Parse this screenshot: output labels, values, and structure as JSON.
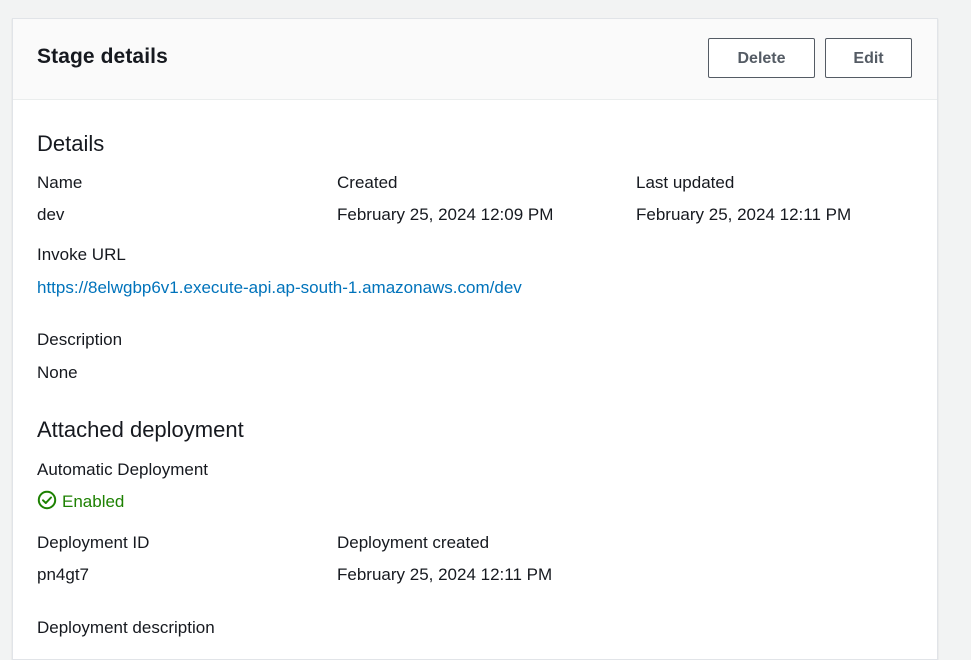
{
  "header": {
    "title": "Stage details",
    "delete_label": "Delete",
    "edit_label": "Edit"
  },
  "details": {
    "section_title": "Details",
    "name_label": "Name",
    "name_value": "dev",
    "created_label": "Created",
    "created_value": "February 25, 2024 12:09 PM",
    "last_updated_label": "Last updated",
    "last_updated_value": "February 25, 2024 12:11 PM",
    "invoke_url_label": "Invoke URL",
    "invoke_url_value": "https://8elwgbp6v1.execute-api.ap-south-1.amazonaws.com/dev",
    "description_label": "Description",
    "description_value": "None"
  },
  "deployment": {
    "section_title": "Attached deployment",
    "auto_label": "Automatic Deployment",
    "auto_value": "Enabled",
    "status_color": "#1d8102",
    "status_icon": "check-circle-icon",
    "id_label": "Deployment ID",
    "id_value": "pn4gt7",
    "created_label": "Deployment created",
    "created_value": "February 25, 2024 12:11 PM",
    "description_label": "Deployment description"
  }
}
